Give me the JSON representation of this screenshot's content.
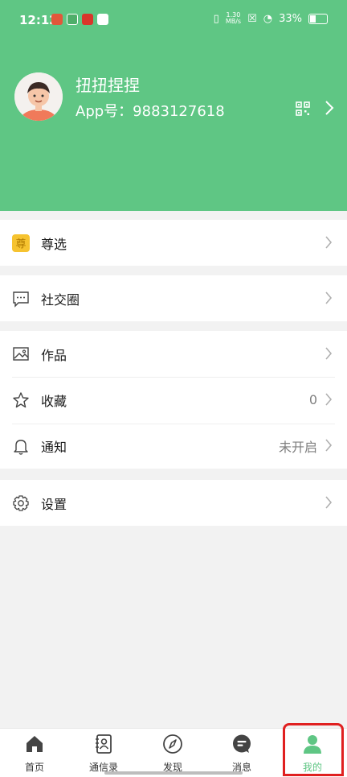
{
  "status_bar": {
    "time": "12:12",
    "net_speed_top": "1.30",
    "net_speed_bottom": "MB/s",
    "battery": "33%"
  },
  "profile": {
    "name": "扭扭捏捏",
    "app_id": "App号：9883127618"
  },
  "menu": {
    "premium": {
      "label": "尊选"
    },
    "social": {
      "label": "社交圈"
    },
    "works": {
      "label": "作品"
    },
    "favorites": {
      "label": "收藏",
      "value": "0"
    },
    "notifications": {
      "label": "通知",
      "value": "未开启"
    },
    "settings": {
      "label": "设置"
    }
  },
  "tabs": [
    {
      "label": "首页",
      "icon": "home-icon"
    },
    {
      "label": "通信录",
      "icon": "contacts-icon"
    },
    {
      "label": "发现",
      "icon": "compass-icon"
    },
    {
      "label": "消息",
      "icon": "chat-icon"
    },
    {
      "label": "我的",
      "icon": "person-icon"
    }
  ],
  "colors": {
    "brand": "#5fc684",
    "highlight": "#e02020",
    "premium_icon": "#f6c330"
  }
}
